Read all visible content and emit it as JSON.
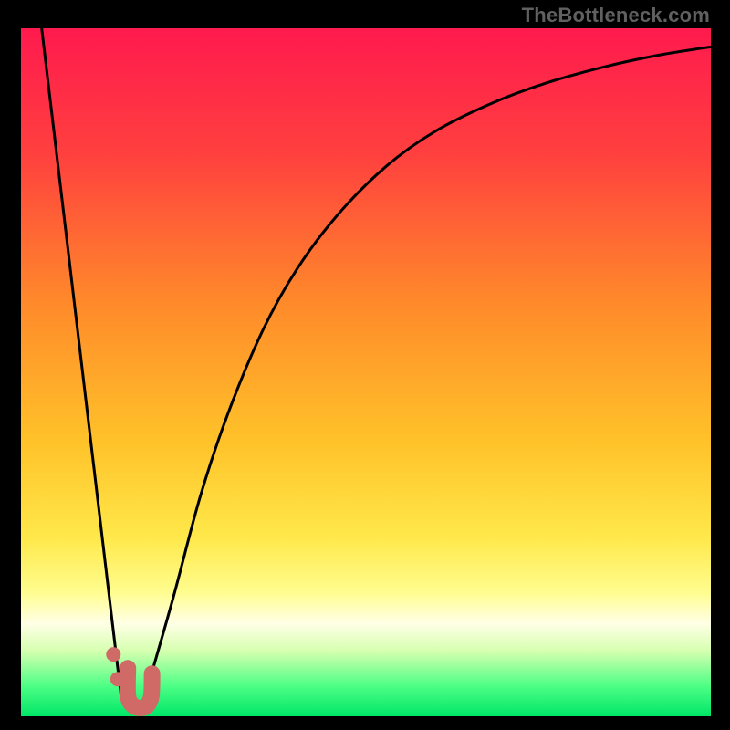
{
  "watermark": "TheBottleneck.com",
  "colors": {
    "black": "#000000",
    "curve": "#000000",
    "marker_fill": "#cf6a67",
    "gradient_stops": [
      {
        "offset": 0.0,
        "color": "#ff1a4e"
      },
      {
        "offset": 0.18,
        "color": "#ff3f3f"
      },
      {
        "offset": 0.4,
        "color": "#ff8a2a"
      },
      {
        "offset": 0.6,
        "color": "#ffc229"
      },
      {
        "offset": 0.74,
        "color": "#ffe84a"
      },
      {
        "offset": 0.82,
        "color": "#fffd8f"
      },
      {
        "offset": 0.865,
        "color": "#ffffe6"
      },
      {
        "offset": 0.905,
        "color": "#d6ffb0"
      },
      {
        "offset": 0.955,
        "color": "#4fff86"
      },
      {
        "offset": 1.0,
        "color": "#00e667"
      }
    ]
  },
  "chart_data": {
    "type": "line",
    "title": "",
    "xlabel": "",
    "ylabel": "",
    "xlim": [
      0,
      100
    ],
    "ylim": [
      0,
      100
    ],
    "series": [
      {
        "name": "left-branch",
        "x": [
          3,
          14.5
        ],
        "y": [
          100,
          3
        ],
        "style": "line"
      },
      {
        "name": "right-branch",
        "x": [
          18,
          22,
          26,
          30,
          35,
          40,
          46,
          53,
          60,
          68,
          76,
          85,
          93,
          100
        ],
        "y": [
          3,
          17,
          32,
          44,
          56,
          65,
          73,
          80,
          85,
          89,
          92,
          94.5,
          96.2,
          97.3
        ],
        "style": "curve"
      },
      {
        "name": "minimum-marker-j",
        "x": [
          15.5,
          15.5,
          16.2,
          17.3,
          18.3,
          18.9,
          19.0
        ],
        "y": [
          7.0,
          3.0,
          1.6,
          1.2,
          1.6,
          3.0,
          6.2
        ],
        "style": "thick"
      }
    ],
    "markers": {
      "dots": [
        {
          "x": 13.4,
          "y": 9.0
        },
        {
          "x": 14.0,
          "y": 5.4
        }
      ]
    }
  }
}
